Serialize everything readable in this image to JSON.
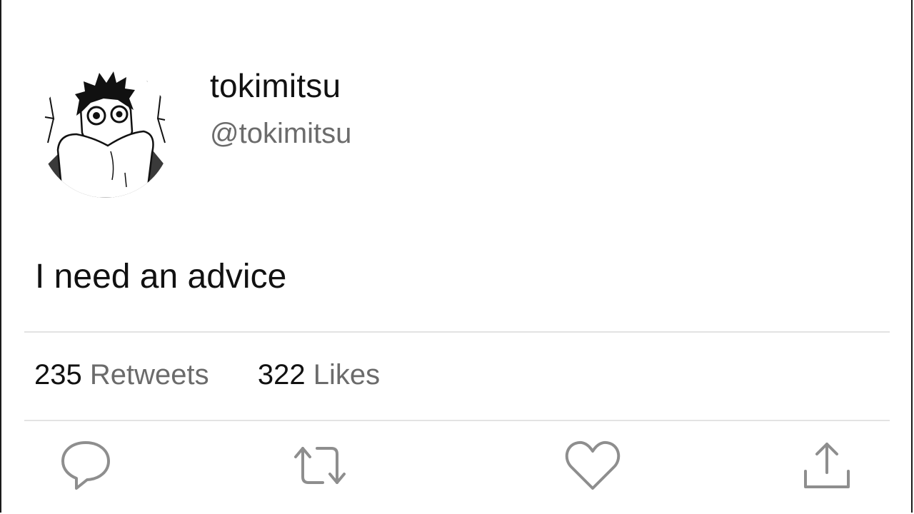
{
  "tweet": {
    "display_name": "tokimitsu",
    "handle": "@tokimitsu",
    "text": "I need an advice",
    "retweets_count": "235",
    "retweets_label": "Retweets",
    "likes_count": "322",
    "likes_label": "Likes"
  },
  "actions": [
    {
      "name": "reply",
      "icon": "reply-icon"
    },
    {
      "name": "retweet",
      "icon": "retweet-icon"
    },
    {
      "name": "like",
      "icon": "heart-icon"
    },
    {
      "name": "share",
      "icon": "share-icon"
    }
  ],
  "colors": {
    "text_primary": "#111111",
    "text_secondary": "#6b6b6b",
    "icon_gray": "#8e8e8e",
    "divider": "#e3e3e3"
  }
}
